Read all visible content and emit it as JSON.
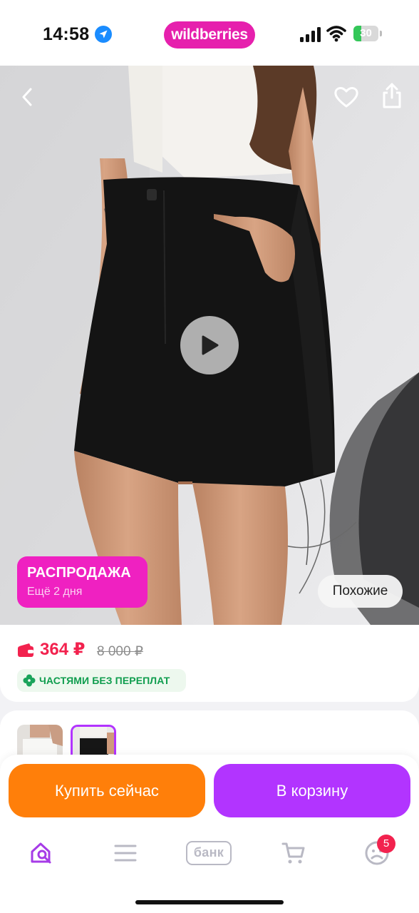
{
  "status_bar": {
    "time": "14:58",
    "brand": "wildberries",
    "battery": "30",
    "battery_level": 0.3
  },
  "hero": {
    "sale_badge": {
      "title": "РАСПРОДАЖА",
      "subtitle": "Ещё 2 дня"
    },
    "similar_label": "Похожие"
  },
  "price": {
    "current": "364 ₽",
    "old": "8 000 ₽",
    "installment": "ЧАСТЯМИ БЕЗ ПЕРЕПЛАТ"
  },
  "actions": {
    "buy_now": "Купить сейчас",
    "add_to_cart": "В корзину"
  },
  "tab_bar": {
    "bank_label": "банк",
    "profile_badge": "5"
  },
  "colors": {
    "brand": "#e620ad",
    "sale_badge": "#ef21c1",
    "price": "#f2224e",
    "buy_now": "#ff7f0a",
    "add_to_cart": "#b234ff",
    "installment": "#0f9d4e",
    "active_tab": "#a63be7"
  },
  "icons": {
    "status": [
      "location-arrow-icon",
      "cellular-signal-icon",
      "wifi-icon",
      "battery-icon"
    ],
    "hero": [
      "back-arrow-icon",
      "heart-icon",
      "share-icon",
      "play-icon"
    ],
    "price": [
      "wallet-icon",
      "clover-icon"
    ],
    "tabs": [
      "home-search-icon",
      "catalog-menu-icon",
      "bank-icon",
      "cart-icon",
      "profile-icon"
    ]
  }
}
